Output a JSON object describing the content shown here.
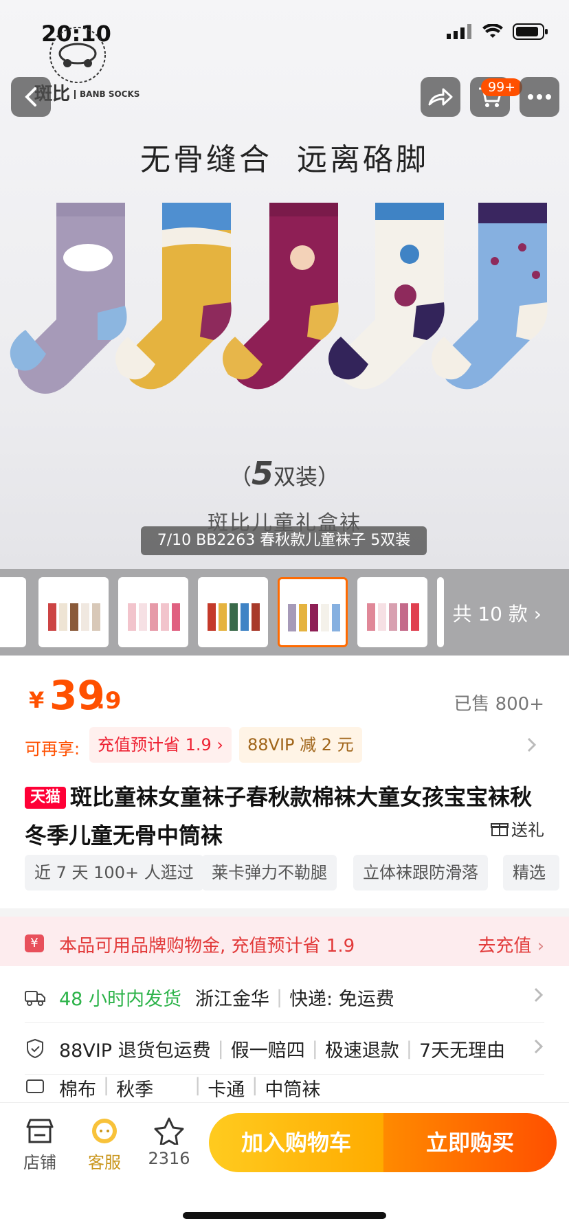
{
  "status_bar": {
    "time": "20:10"
  },
  "brand": {
    "name": "斑比",
    "sub": "BANB SOCKS"
  },
  "nav": {
    "back_icon": "chevron-left-icon",
    "share_icon": "share-icon",
    "cart_badge": "99+",
    "more_icon": "more-icon"
  },
  "hero": {
    "headline": "无骨缝合  远离硌脚",
    "pack_count": "5",
    "pack_label": "双装",
    "gift_box": "斑比儿童礼盒袜",
    "caption": "7/10 BB2263 春秋款儿童袜子 5双装"
  },
  "thumbnails": {
    "more_label": "共 10 款"
  },
  "price": {
    "symbol": "¥",
    "integer": "39",
    "decimal": ".9",
    "sold": "已售 800+"
  },
  "promo": {
    "label": "可再享:",
    "tag1": "充值预计省 1.9 ›",
    "tag2": "88VIP 减 2 元"
  },
  "product": {
    "tmall_badge": "天猫",
    "title": "斑比童袜女童袜子春秋款棉袜大童女孩宝宝袜秋冬季儿童无骨中筒袜",
    "gift_label": "送礼",
    "chips": [
      "近 7 天 100+ 人逛过",
      "莱卡弹力不勒腿",
      "立体袜跟防滑落",
      "精选"
    ]
  },
  "recharge": {
    "text": "本品可用品牌购物金, 充值预计省 1.9",
    "link": "去充值"
  },
  "shipping": {
    "time": "48 小时内发货",
    "origin": "浙江金华",
    "express": "快递: 免运费"
  },
  "service": {
    "items": [
      "88VIP 退货包运费",
      "假一赔四",
      "极速退款",
      "7天无理由"
    ]
  },
  "attributes": {
    "items": [
      "棉布",
      "秋季",
      "卡通",
      "中筒袜"
    ]
  },
  "bottom_bar": {
    "shop": "店铺",
    "service": "客服",
    "favorites": "2316",
    "add_to_cart": "加入购物车",
    "buy_now": "立即购买"
  },
  "colors": {
    "accent": "#ff5000",
    "tmall": "#ff0036",
    "green": "#2db34a"
  }
}
